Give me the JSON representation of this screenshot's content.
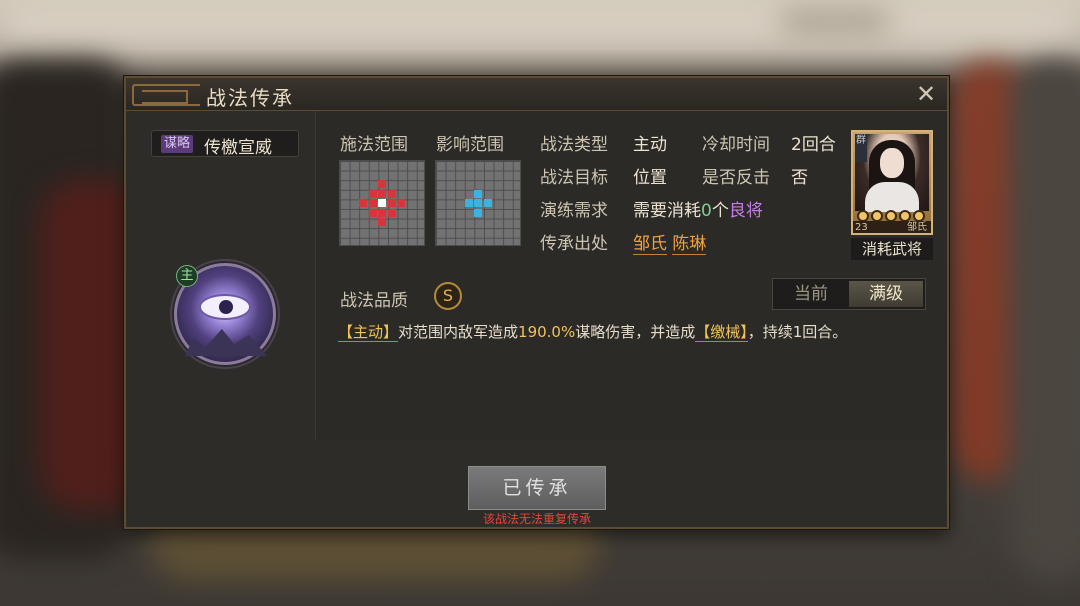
{
  "dialog": {
    "title": "战法传承",
    "close": "✕"
  },
  "skill": {
    "type_tag": "谋略",
    "name": "传檄宣威",
    "main_badge": "主"
  },
  "ranges": {
    "cast_label": "施法范围",
    "effect_label": "影响范围"
  },
  "info": {
    "type_label": "战法类型",
    "type_value": "主动",
    "cooldown_label": "冷却时间",
    "cooldown_value": "2回合",
    "target_label": "战法目标",
    "target_value": "位置",
    "counter_label": "是否反击",
    "counter_value": "否",
    "practice_label": "演练需求",
    "practice_prefix": "需要消耗",
    "practice_count": "0",
    "practice_unit": "个",
    "practice_item": "良将",
    "source_label": "传承出处",
    "source_1": "邹氏",
    "source_2": "陈琳"
  },
  "card": {
    "faction": "群",
    "level": "23",
    "owner": "邹氏",
    "consume_label": "消耗武将",
    "stars": 5
  },
  "quality": {
    "label": "战法品质",
    "grade": "S"
  },
  "toggle": {
    "current": "当前",
    "max": "满级"
  },
  "description": {
    "tag_active": "【主动】",
    "part1": "对范围内敌军造成",
    "damage": "190.0%",
    "part2": "谋略伤害，并造成",
    "tag_status": "【缴械】",
    "part3": "，持续1回合。"
  },
  "footer": {
    "button": "已传承",
    "note": "该战法无法重复传承"
  },
  "colors": {
    "range_red": "#d9343a",
    "range_center": "#ffffff",
    "range_blue": "#3bb3e0",
    "accent_orange": "#f0a040",
    "accent_purple": "#c67ce8"
  }
}
